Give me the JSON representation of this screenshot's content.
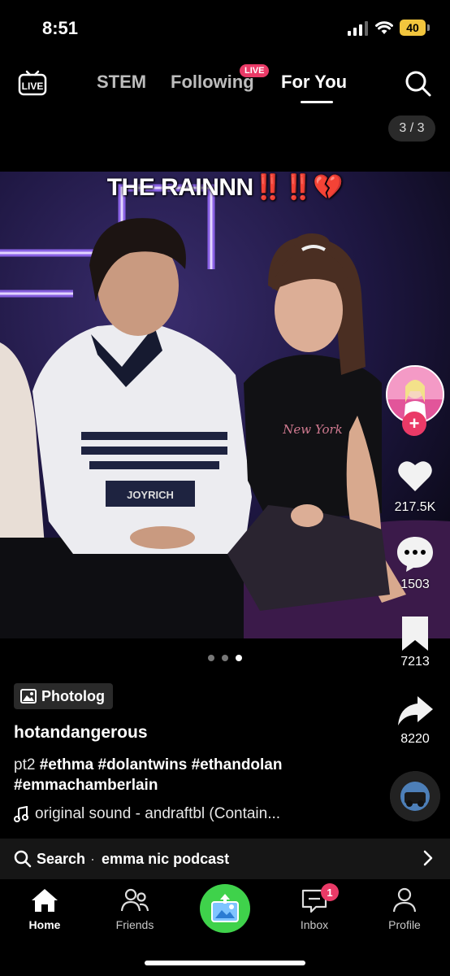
{
  "status": {
    "time": "8:51",
    "battery": "40"
  },
  "top_nav": {
    "live_icon_label": "LIVE",
    "tabs": [
      {
        "label": "STEM",
        "active": false
      },
      {
        "label": "Following",
        "active": false
      },
      {
        "label": "For You",
        "active": true
      }
    ],
    "live_badge": "LIVE",
    "counter": "3 / 3"
  },
  "post": {
    "caption": "THE RAINNN",
    "caption_emoji": "‼️‼️💔",
    "shirt_text": "JOYRICH",
    "shirt_text_2": "New York",
    "carousel": {
      "count": 3,
      "active": 3
    },
    "photolog_label": "Photolog",
    "username": "hotandangerous",
    "description_prefix": "pt2 ",
    "hashtags": "#ethma #dolantwins #ethandolan #emmachamberlain",
    "sound": "original sound - andraftbl (Contain..."
  },
  "rail": {
    "likes": "217.5K",
    "comments": "1503",
    "saves": "7213",
    "shares": "8220"
  },
  "search_bar": {
    "label": "Search",
    "separator": "·",
    "query": "emma nic podcast"
  },
  "bottom_nav": {
    "home": "Home",
    "friends": "Friends",
    "inbox": "Inbox",
    "inbox_badge": "1",
    "profile": "Profile"
  },
  "colors": {
    "accent": "#ea3a67",
    "create": "#3fd24b",
    "battery": "#f2c53d"
  }
}
